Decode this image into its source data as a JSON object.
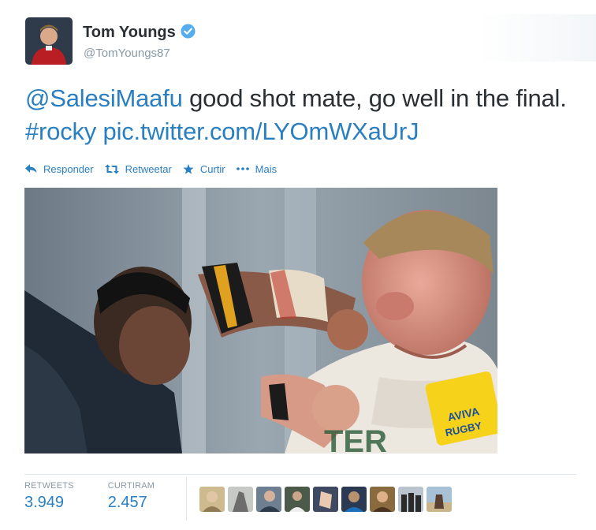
{
  "author": {
    "name": "Tom Youngs",
    "handle": "@TomYoungs87",
    "verified": true,
    "avatar_icon": "profile-photo"
  },
  "tweet": {
    "mention": "@SalesiMaafu",
    "text": " good shot mate, go well in the final. ",
    "hashtag": "#rocky",
    "link": "pic.twitter.com/LYOmWXaUrJ"
  },
  "actions": {
    "reply": "Responder",
    "retweet": "Retweetar",
    "favorite": "Curtir",
    "more": "Mais"
  },
  "stats": {
    "retweets_label": "RETWEETS",
    "retweets_value": "3.949",
    "favorites_label": "CURTIRAM",
    "favorites_value": "2.457"
  },
  "colors": {
    "link": "#2a7fc1",
    "text": "#292f33",
    "muted": "#8899a6",
    "verified": "#55acee"
  },
  "favoriters": [
    {
      "icon": "user-avatar"
    },
    {
      "icon": "user-avatar"
    },
    {
      "icon": "user-avatar"
    },
    {
      "icon": "user-avatar"
    },
    {
      "icon": "user-avatar"
    },
    {
      "icon": "user-avatar"
    },
    {
      "icon": "user-avatar"
    },
    {
      "icon": "user-avatar"
    },
    {
      "icon": "user-avatar"
    }
  ]
}
